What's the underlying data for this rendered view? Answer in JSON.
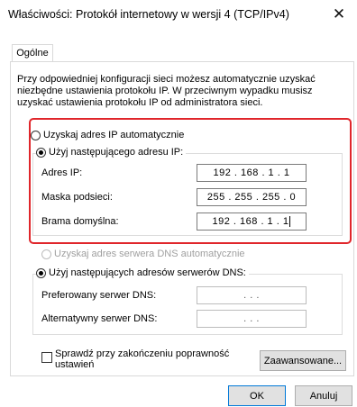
{
  "window": {
    "title": "Właściwości: Protokół internetowy w wersji 4 (TCP/IPv4)",
    "close_glyph": "✕"
  },
  "tabs": [
    {
      "label": "Ogólne",
      "active": true
    }
  ],
  "description": "Przy odpowiedniej konfiguracji sieci możesz automatycznie uzyskać niezbędne ustawienia protokołu IP. W przeciwnym wypadku musisz uzyskać ustawienia protokołu IP od administratora sieci.",
  "ip_section": {
    "auto_radio": {
      "label": "Uzyskaj adres IP automatycznie",
      "selected": false
    },
    "manual_radio": {
      "label": "Użyj następującego adresu IP:",
      "selected": true
    },
    "fields": [
      {
        "label": "Adres IP:",
        "value": "192 . 168 . 1 . 1"
      },
      {
        "label": "Maska podsieci:",
        "value": "255 . 255 . 255 . 0"
      },
      {
        "label": "Brama domyślna:",
        "value": "192 . 168 . 1 . 1"
      }
    ]
  },
  "dns_section": {
    "auto_radio": {
      "label": "Uzyskaj adres serwera DNS automatycznie",
      "selected": false,
      "disabled": true
    },
    "manual_radio": {
      "label": "Użyj następujących adresów serwerów DNS:",
      "selected": true
    },
    "fields": [
      {
        "label": "Preferowany serwer DNS:",
        "value": " .  .  . "
      },
      {
        "label": "Alternatywny serwer DNS:",
        "value": " .  .  . "
      }
    ]
  },
  "validate_checkbox": {
    "label": "Sprawdź przy zakończeniu poprawność ustawień",
    "checked": false
  },
  "buttons": {
    "advanced": "Zaawansowane...",
    "ok": "OK",
    "cancel": "Anuluj"
  },
  "colors": {
    "highlight_border": "#e0262b",
    "primary_button_border": "#0078d7"
  }
}
